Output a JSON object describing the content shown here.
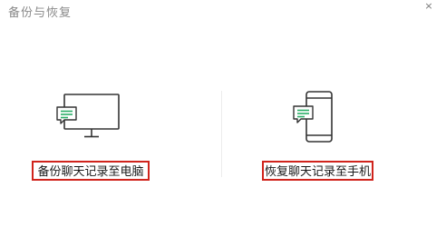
{
  "window": {
    "title": "备份与恢复",
    "close_icon": "close-icon",
    "close_glyph": "×"
  },
  "options": [
    {
      "label": "备份聊天记录至电脑",
      "icon": "monitor-chat-icon"
    },
    {
      "label": "恢复聊天记录至手机",
      "icon": "phone-chat-icon"
    }
  ],
  "colors": {
    "highlight_border": "#d0241c",
    "chat_bubble_accent": "#2aae67",
    "icon_stroke": "#333333"
  }
}
